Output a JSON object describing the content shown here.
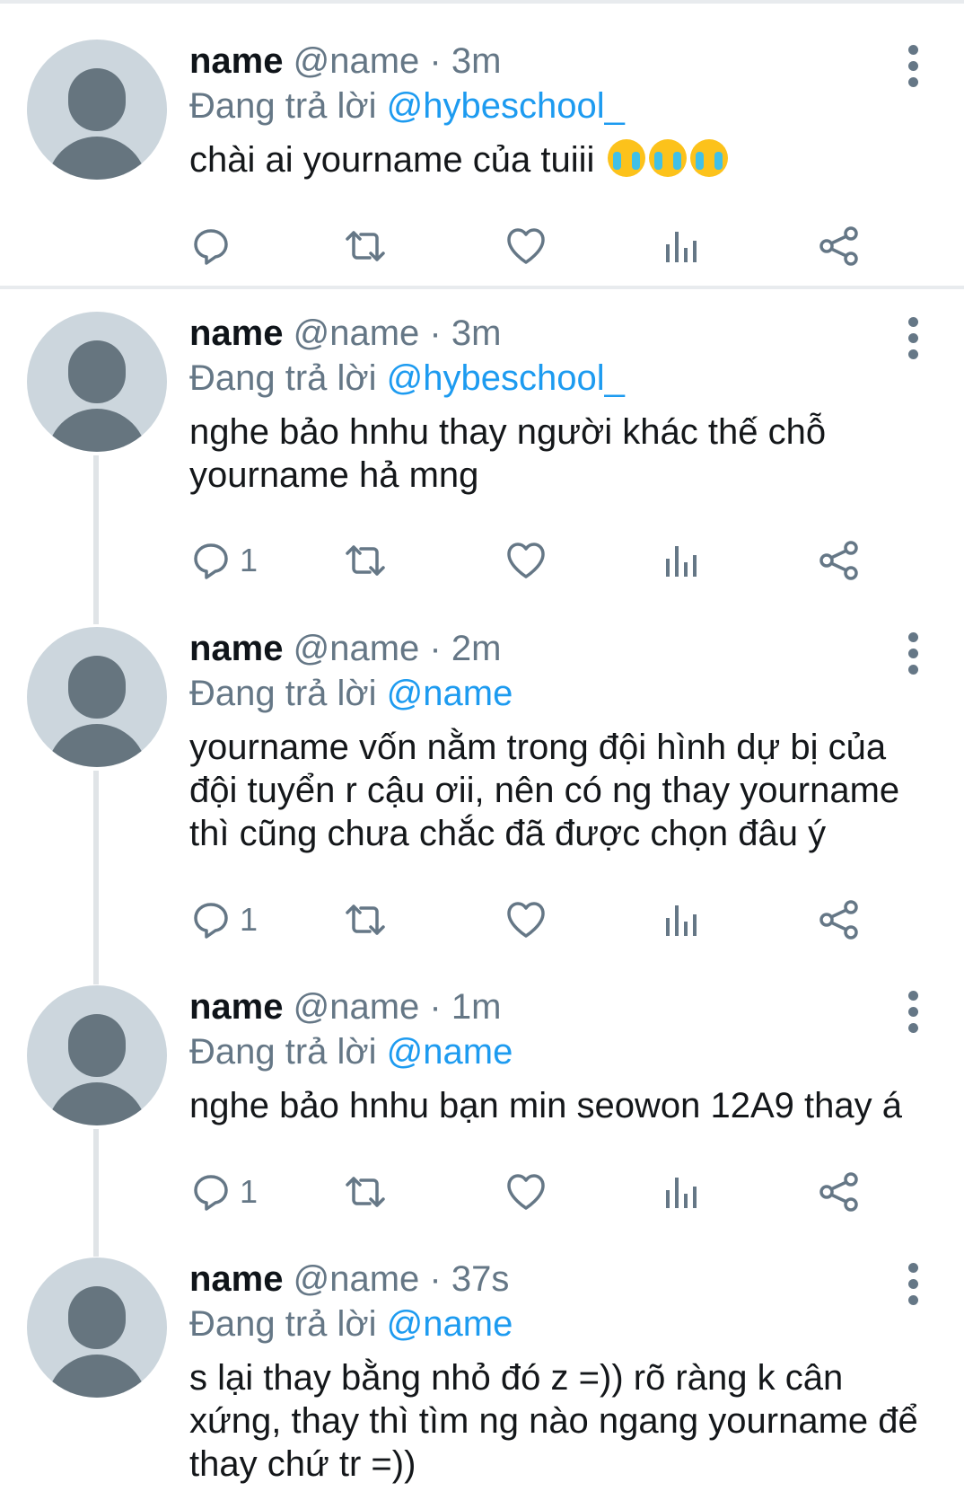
{
  "tweets": [
    {
      "display_name": "name",
      "handle": "@name",
      "time": "· 3m",
      "replying_label": "Đang trả lời",
      "replying_to": "@hybeschool_",
      "text": "chài ai yourname của tuiii",
      "emojis": [
        "loudly-crying-face",
        "loudly-crying-face",
        "loudly-crying-face"
      ],
      "reply_count": ""
    },
    {
      "display_name": "name",
      "handle": "@name",
      "time": "· 3m",
      "replying_label": "Đang trả lời",
      "replying_to": "@hybeschool_",
      "text": "nghe bảo hnhu thay người khác thế chỗ yourname hả mng",
      "reply_count": "1"
    },
    {
      "display_name": "name",
      "handle": "@name",
      "time": "· 2m",
      "replying_label": "Đang trả lời",
      "replying_to": "@name",
      "text": "yourname vốn nằm trong đội hình dự bị của đội tuyển r cậu ơii, nên có ng thay yourname thì cũng chưa chắc đã được chọn đâu ý",
      "reply_count": "1"
    },
    {
      "display_name": "name",
      "handle": "@name",
      "time": "· 1m",
      "replying_label": "Đang trả lời",
      "replying_to": "@name",
      "text": "nghe bảo hnhu bạn min seowon 12A9 thay á",
      "reply_count": "1"
    },
    {
      "display_name": "name",
      "handle": "@name",
      "time": "· 37s",
      "replying_label": "Đang trả lời",
      "replying_to": "@name",
      "text": "s lại thay bằng nhỏ đó z =)) rõ ràng k cân xứng, thay thì tìm ng nào ngang yourname để thay chứ tr =))",
      "reply_count": ""
    }
  ],
  "icons": {
    "reply": "reply-icon",
    "retweet": "retweet-icon",
    "like": "like-icon",
    "analytics": "analytics-icon",
    "share": "share-icon",
    "menu": "more-options-icon"
  },
  "colors": {
    "link": "#1d9bf0",
    "secondary_text": "#657786",
    "avatar_bg": "#ccd6dd",
    "avatar_fg": "#66757f",
    "divider": "#e8ebee"
  }
}
